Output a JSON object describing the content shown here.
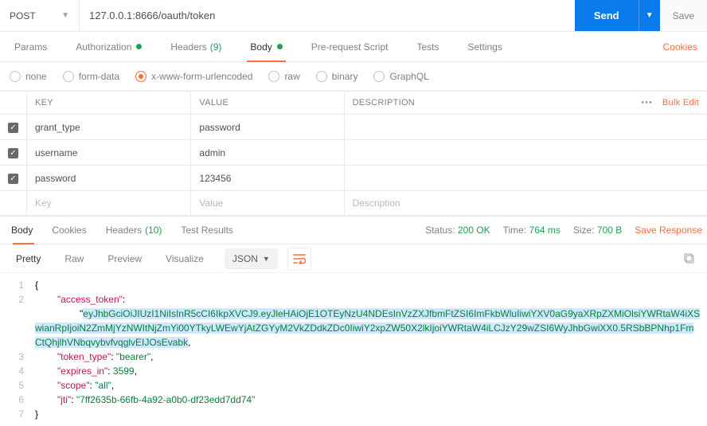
{
  "request": {
    "method": "POST",
    "url": "127.0.0.1:8666/oauth/token",
    "send_label": "Send",
    "save_label": "Save"
  },
  "tabs": {
    "params": "Params",
    "authorization": "Authorization",
    "headers": "Headers",
    "headers_count": "(9)",
    "body": "Body",
    "prerequest": "Pre-request Script",
    "tests": "Tests",
    "settings": "Settings",
    "cookies": "Cookies"
  },
  "body_types": {
    "none": "none",
    "form_data": "form-data",
    "xwww": "x-www-form-urlencoded",
    "raw": "raw",
    "binary": "binary",
    "graphql": "GraphQL"
  },
  "table": {
    "h_key": "KEY",
    "h_value": "VALUE",
    "h_desc": "DESCRIPTION",
    "bulk": "Bulk Edit",
    "rows": [
      {
        "key": "grant_type",
        "value": "password",
        "desc": ""
      },
      {
        "key": "username",
        "value": "admin",
        "desc": ""
      },
      {
        "key": "password",
        "value": "123456",
        "desc": ""
      }
    ],
    "ph_key": "Key",
    "ph_value": "Value",
    "ph_desc": "Description"
  },
  "resp_tabs": {
    "body": "Body",
    "cookies": "Cookies",
    "headers": "Headers",
    "headers_count": "(10)",
    "tests": "Test Results"
  },
  "status": {
    "label_status": "Status:",
    "status_value": "200 OK",
    "label_time": "Time:",
    "time_value": "764 ms",
    "label_size": "Size:",
    "size_value": "700 B",
    "save_response": "Save Response"
  },
  "views": {
    "pretty": "Pretty",
    "raw": "Raw",
    "preview": "Preview",
    "visualize": "Visualize",
    "json": "JSON"
  },
  "response_json": {
    "access_token_key": "\"access_token\"",
    "access_token_val": "\"eyJhbGciOiJIUzI1NiIsInR5cCI6IkpXVCJ9.eyJleHAiOjE1OTEyNzU4NDEsInVzZXJfbmFtZSI6ImFkbWluIiwiYXV0aG9yaXRpZXMiOlsiYWRtaW4iXSwianRpIjoiN2ZmMjYzNWItNjZmYi00YTkyLWEwYjAtZGYyM2VkZDdkZDc0IiwiY2xpZW50X2lkIjoiYWRtaW4iLCJzY29wZSI6WyJhbGwiXX0.5RSbBPNhp1FmCtQhjlhVNbqvybvfvqglvEIJOsEvabk\"",
    "token_type_key": "\"token_type\"",
    "token_type_val": "\"bearer\"",
    "expires_in_key": "\"expires_in\"",
    "expires_in_val": "3599",
    "scope_key": "\"scope\"",
    "scope_val": "\"all\"",
    "jti_key": "\"jti\"",
    "jti_val": "\"7ff2635b-66fb-4a92-a0b0-df23edd7dd74\""
  }
}
